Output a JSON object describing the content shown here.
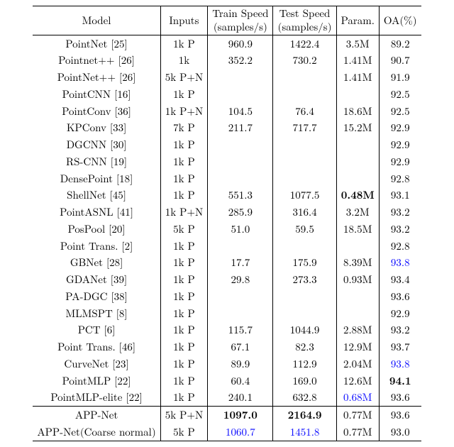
{
  "headers": {
    "model": "Model",
    "inputs": "Inputs",
    "train_top": "Train Speed",
    "train_bot": "(samples/s)",
    "test_top": "Test Speed",
    "test_bot": "(samples/s)",
    "param": "Param.",
    "oa": "OA(%)"
  },
  "rows": [
    {
      "model": "PointNet [25]",
      "inputs": "1k P",
      "train": "960.9",
      "test": "1422.4",
      "param": "3.5M",
      "oa": "89.2"
    },
    {
      "model": "Pointnet++ [26]",
      "inputs": "1k",
      "train": "352.2",
      "test": "730.2",
      "param": "1.41M",
      "oa": "90.7"
    },
    {
      "model": "PointNet++ [26]",
      "inputs": "5k P+N",
      "train": "",
      "test": "",
      "param": "1.41M",
      "oa": "91.9"
    },
    {
      "model": "PointCNN [16]",
      "inputs": "1k P",
      "train": "",
      "test": "",
      "param": "",
      "oa": "92.5"
    },
    {
      "model": "PointConv [36]",
      "inputs": "1k P+N",
      "train": "104.5",
      "test": "76.4",
      "param": "18.6M",
      "oa": "92.5"
    },
    {
      "model": "KPConv [33]",
      "inputs": "7k P",
      "train": "211.7",
      "test": "717.7",
      "param": "15.2M",
      "oa": "92.9"
    },
    {
      "model": "DGCNN [30]",
      "inputs": "1k P",
      "train": "",
      "test": "",
      "param": "",
      "oa": "92.9"
    },
    {
      "model": "RS-CNN [19]",
      "inputs": "1k P",
      "train": "",
      "test": "",
      "param": "",
      "oa": "92.9"
    },
    {
      "model": "DensePoint [18]",
      "inputs": "1k P",
      "train": "",
      "test": "",
      "param": "",
      "oa": "92.8"
    },
    {
      "model": "ShellNet [45]",
      "inputs": "1k P",
      "train": "551.3",
      "test": "1077.5",
      "param": "0.48M",
      "param_bold": true,
      "oa": "93.1"
    },
    {
      "model": "PointASNL [41]",
      "inputs": "1k P+N",
      "train": "285.9",
      "test": "316.4",
      "param": "3.2M",
      "oa": "93.2"
    },
    {
      "model": "PosPool [20]",
      "inputs": "5k P",
      "train": "51.0",
      "test": "59.5",
      "param": "18.5M",
      "oa": "93.2"
    },
    {
      "model": "Point Trans. [2]",
      "inputs": "1k P",
      "train": "",
      "test": "",
      "param": "",
      "oa": "92.8"
    },
    {
      "model": "GBNet [28]",
      "inputs": "1k P",
      "train": "17.7",
      "test": "175.9",
      "param": "8.39M",
      "oa": "93.8",
      "oa_blue": true
    },
    {
      "model": "GDANet [39]",
      "inputs": "1k P",
      "train": "29.8",
      "test": "273.3",
      "param": "0.93M",
      "oa": "93.4"
    },
    {
      "model": "PA-DGC [38]",
      "inputs": "1k P",
      "train": "",
      "test": "",
      "param": "",
      "oa": "93.6"
    },
    {
      "model": "MLMSPT [8]",
      "inputs": "1k P",
      "train": "",
      "test": "",
      "param": "",
      "oa": "92.9"
    },
    {
      "model": "PCT [6]",
      "inputs": "1k P",
      "train": "115.7",
      "test": "1044.9",
      "param": "2.88M",
      "oa": "93.2"
    },
    {
      "model": "Point Trans. [46]",
      "inputs": "1k P",
      "train": "67.1",
      "test": "82.3",
      "param": "12.9M",
      "oa": "93.7"
    },
    {
      "model": "CurveNet [23]",
      "inputs": "1k P",
      "train": "89.9",
      "test": "112.9",
      "param": "2.04M",
      "oa": "93.8",
      "oa_blue": true
    },
    {
      "model": "PointMLP [22]",
      "inputs": "1k P",
      "train": "60.4",
      "test": "169.0",
      "param": "12.6M",
      "oa": "94.1",
      "oa_bold": true
    },
    {
      "model": "PointMLP-elite [22]",
      "inputs": "1k P",
      "train": "240.1",
      "test": "632.8",
      "param": "0.68M",
      "param_blue": true,
      "oa": "93.6"
    }
  ],
  "bottom": [
    {
      "model": "APP-Net",
      "inputs": "5k P+N",
      "train": "1097.0",
      "train_bold": true,
      "test": "2164.9",
      "test_bold": true,
      "param": "0.77M",
      "oa": "93.6"
    },
    {
      "model": "APP-Net(Coarse normal)",
      "inputs": "5k P",
      "train": "1060.7",
      "train_blue": true,
      "test": "1451.8",
      "test_blue": true,
      "param": "0.77M",
      "oa": "93.0"
    }
  ],
  "chart_data": {
    "type": "table",
    "title": "",
    "columns": [
      "Model",
      "Inputs",
      "Train Speed (samples/s)",
      "Test Speed (samples/s)",
      "Param.",
      "OA(%)"
    ],
    "rows": [
      [
        "PointNet [25]",
        "1k P",
        960.9,
        1422.4,
        "3.5M",
        89.2
      ],
      [
        "Pointnet++ [26]",
        "1k",
        352.2,
        730.2,
        "1.41M",
        90.7
      ],
      [
        "PointNet++ [26]",
        "5k P+N",
        null,
        null,
        "1.41M",
        91.9
      ],
      [
        "PointCNN [16]",
        "1k P",
        null,
        null,
        null,
        92.5
      ],
      [
        "PointConv [36]",
        "1k P+N",
        104.5,
        76.4,
        "18.6M",
        92.5
      ],
      [
        "KPConv [33]",
        "7k P",
        211.7,
        717.7,
        "15.2M",
        92.9
      ],
      [
        "DGCNN [30]",
        "1k P",
        null,
        null,
        null,
        92.9
      ],
      [
        "RS-CNN [19]",
        "1k P",
        null,
        null,
        null,
        92.9
      ],
      [
        "DensePoint [18]",
        "1k P",
        null,
        null,
        null,
        92.8
      ],
      [
        "ShellNet [45]",
        "1k P",
        551.3,
        1077.5,
        "0.48M",
        93.1
      ],
      [
        "PointASNL [41]",
        "1k P+N",
        285.9,
        316.4,
        "3.2M",
        93.2
      ],
      [
        "PosPool [20]",
        "5k P",
        51.0,
        59.5,
        "18.5M",
        93.2
      ],
      [
        "Point Trans. [2]",
        "1k P",
        null,
        null,
        null,
        92.8
      ],
      [
        "GBNet [28]",
        "1k P",
        17.7,
        175.9,
        "8.39M",
        93.8
      ],
      [
        "GDANet [39]",
        "1k P",
        29.8,
        273.3,
        "0.93M",
        93.4
      ],
      [
        "PA-DGC [38]",
        "1k P",
        null,
        null,
        null,
        93.6
      ],
      [
        "MLMSPT [8]",
        "1k P",
        null,
        null,
        null,
        92.9
      ],
      [
        "PCT [6]",
        "1k P",
        115.7,
        1044.9,
        "2.88M",
        93.2
      ],
      [
        "Point Trans. [46]",
        "1k P",
        67.1,
        82.3,
        "12.9M",
        93.7
      ],
      [
        "CurveNet [23]",
        "1k P",
        89.9,
        112.9,
        "2.04M",
        93.8
      ],
      [
        "PointMLP [22]",
        "1k P",
        60.4,
        169.0,
        "12.6M",
        94.1
      ],
      [
        "PointMLP-elite [22]",
        "1k P",
        240.1,
        632.8,
        "0.68M",
        93.6
      ],
      [
        "APP-Net",
        "5k P+N",
        1097.0,
        2164.9,
        "0.77M",
        93.6
      ],
      [
        "APP-Net(Coarse normal)",
        "5k P",
        1060.7,
        1451.8,
        "0.77M",
        93.0
      ]
    ]
  }
}
